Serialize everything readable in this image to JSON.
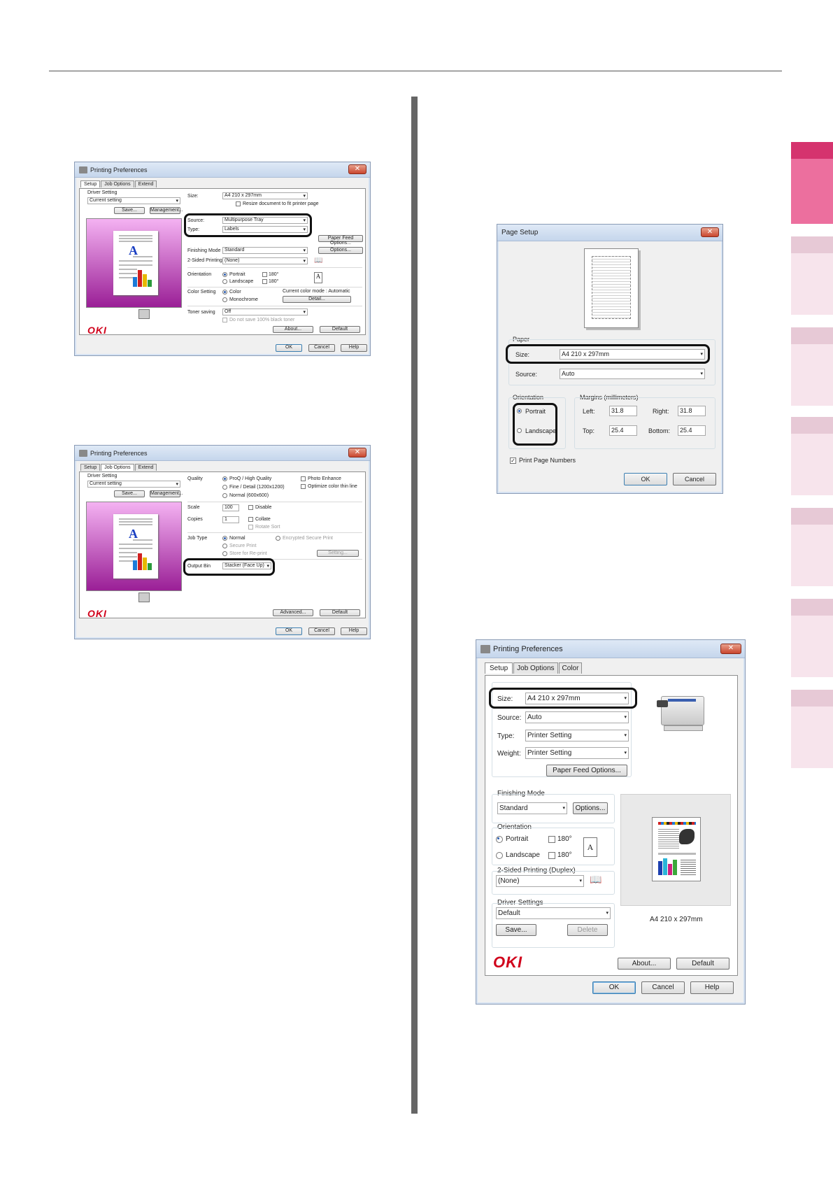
{
  "side_tabs": [
    {
      "cap": "#d5336e",
      "body": "#ec6f9e"
    },
    {
      "cap": "#e7c9d6",
      "body": "#f7e4ec"
    },
    {
      "cap": "#e7c9d6",
      "body": "#f7e4ec"
    },
    {
      "cap": "#e7c9d6",
      "body": "#f7e4ec"
    },
    {
      "cap": "#e7c9d6",
      "body": "#f7e4ec"
    },
    {
      "cap": "#e7c9d6",
      "body": "#f7e4ec"
    },
    {
      "cap": "#e7c9d6",
      "body": "#f7e4ec"
    }
  ],
  "dlg1": {
    "title": "Printing Preferences",
    "tabs": [
      "Setup",
      "Job Options",
      "Extend"
    ],
    "driver_setting_label": "Driver Setting",
    "driver_setting_value": "Current setting",
    "save": "Save...",
    "management": "Management...",
    "size_label": "Size:",
    "size_value": "A4 210 x 297mm",
    "resize_label": "Resize document to fit printer page",
    "source_label": "Source:",
    "source_value": "Multipurpose Tray",
    "type_label": "Type:",
    "type_value": "Labels",
    "paper_feed_options": "Paper Feed Options...",
    "finishing_label": "Finishing Mode",
    "finishing_value": "Standard",
    "options": "Options...",
    "two_sided_label": "2-Sided Printing",
    "two_sided_value": "(None)",
    "orientation_label": "Orientation",
    "portrait": "Portrait",
    "landscape": "Landscape",
    "deg180": "180°",
    "color_label": "Color Setting",
    "color": "Color",
    "monochrome": "Monochrome",
    "color_mode": "Current color mode : Automatic",
    "detail": "Detail...",
    "toner_label": "Toner saving",
    "toner_value": "Off",
    "do_not_save": "Do not save 100% black toner",
    "about": "About...",
    "default": "Default",
    "ok": "OK",
    "cancel": "Cancel",
    "help": "Help",
    "logo": "OKI"
  },
  "dlg2": {
    "title": "Printing Preferences",
    "tabs": [
      "Setup",
      "Job Options",
      "Extend"
    ],
    "driver_setting_label": "Driver Setting",
    "driver_setting_value": "Current setting",
    "save": "Save...",
    "management": "Management...",
    "quality_label": "Quality",
    "quality_1": "ProQ / High Quality",
    "quality_2": "Fine / Detail (1200x1200)",
    "quality_3": "Normal (600x600)",
    "photo_enhance": "Photo Enhance",
    "optimize_thin": "Optimize color thin line",
    "scale_label": "Scale",
    "scale_value": "100",
    "disable": "Disable",
    "copies_label": "Copies",
    "copies_value": "1",
    "collate": "Collate",
    "rotate_sort": "Rotate Sort",
    "job_type_label": "Job Type",
    "normal": "Normal",
    "encrypted": "Encrypted Secure Print",
    "secure_print": "Secure Print",
    "store_reprint": "Store for Re-print",
    "setting": "Setting...",
    "output_bin_label": "Output Bin",
    "output_bin_value": "Stacker (Face Up)",
    "advanced": "Advanced...",
    "default": "Default",
    "ok": "OK",
    "cancel": "Cancel",
    "help": "Help",
    "logo": "OKI"
  },
  "dlg3": {
    "title": "Page Setup",
    "paper_label": "Paper",
    "size_label": "Size:",
    "size_value": "A4 210 x 297mm",
    "source_label": "Source:",
    "source_value": "Auto",
    "orientation_label": "Orientation",
    "portrait": "Portrait",
    "landscape": "Landscape",
    "margins_label": "Margins (millimeters)",
    "left_label": "Left:",
    "left_value": "31.8",
    "right_label": "Right:",
    "right_value": "31.8",
    "top_label": "Top:",
    "top_value": "25.4",
    "bottom_label": "Bottom:",
    "bottom_value": "25.4",
    "print_page_numbers": "Print Page Numbers",
    "ok": "OK",
    "cancel": "Cancel"
  },
  "dlg4": {
    "title": "Printing Preferences",
    "tabs": [
      "Setup",
      "Job Options",
      "Color"
    ],
    "size_label": "Size:",
    "size_value": "A4 210 x 297mm",
    "source_label": "Source:",
    "source_value": "Auto",
    "type_label": "Type:",
    "type_value": "Printer Setting",
    "weight_label": "Weight:",
    "weight_value": "Printer Setting",
    "paper_feed_options": "Paper Feed Options...",
    "finishing_label": "Finishing Mode",
    "finishing_value": "Standard",
    "options": "Options...",
    "orientation_label": "Orientation",
    "portrait": "Portrait",
    "landscape": "Landscape",
    "deg180": "180°",
    "two_sided_label": "2-Sided Printing (Duplex)",
    "two_sided_value": "(None)",
    "driver_settings_label": "Driver Settings",
    "driver_settings_value": "Default",
    "save": "Save...",
    "delete": "Delete",
    "preview_caption": "A4 210 x 297mm",
    "about": "About...",
    "default": "Default",
    "ok": "OK",
    "cancel": "Cancel",
    "help": "Help",
    "logo": "OKI"
  }
}
